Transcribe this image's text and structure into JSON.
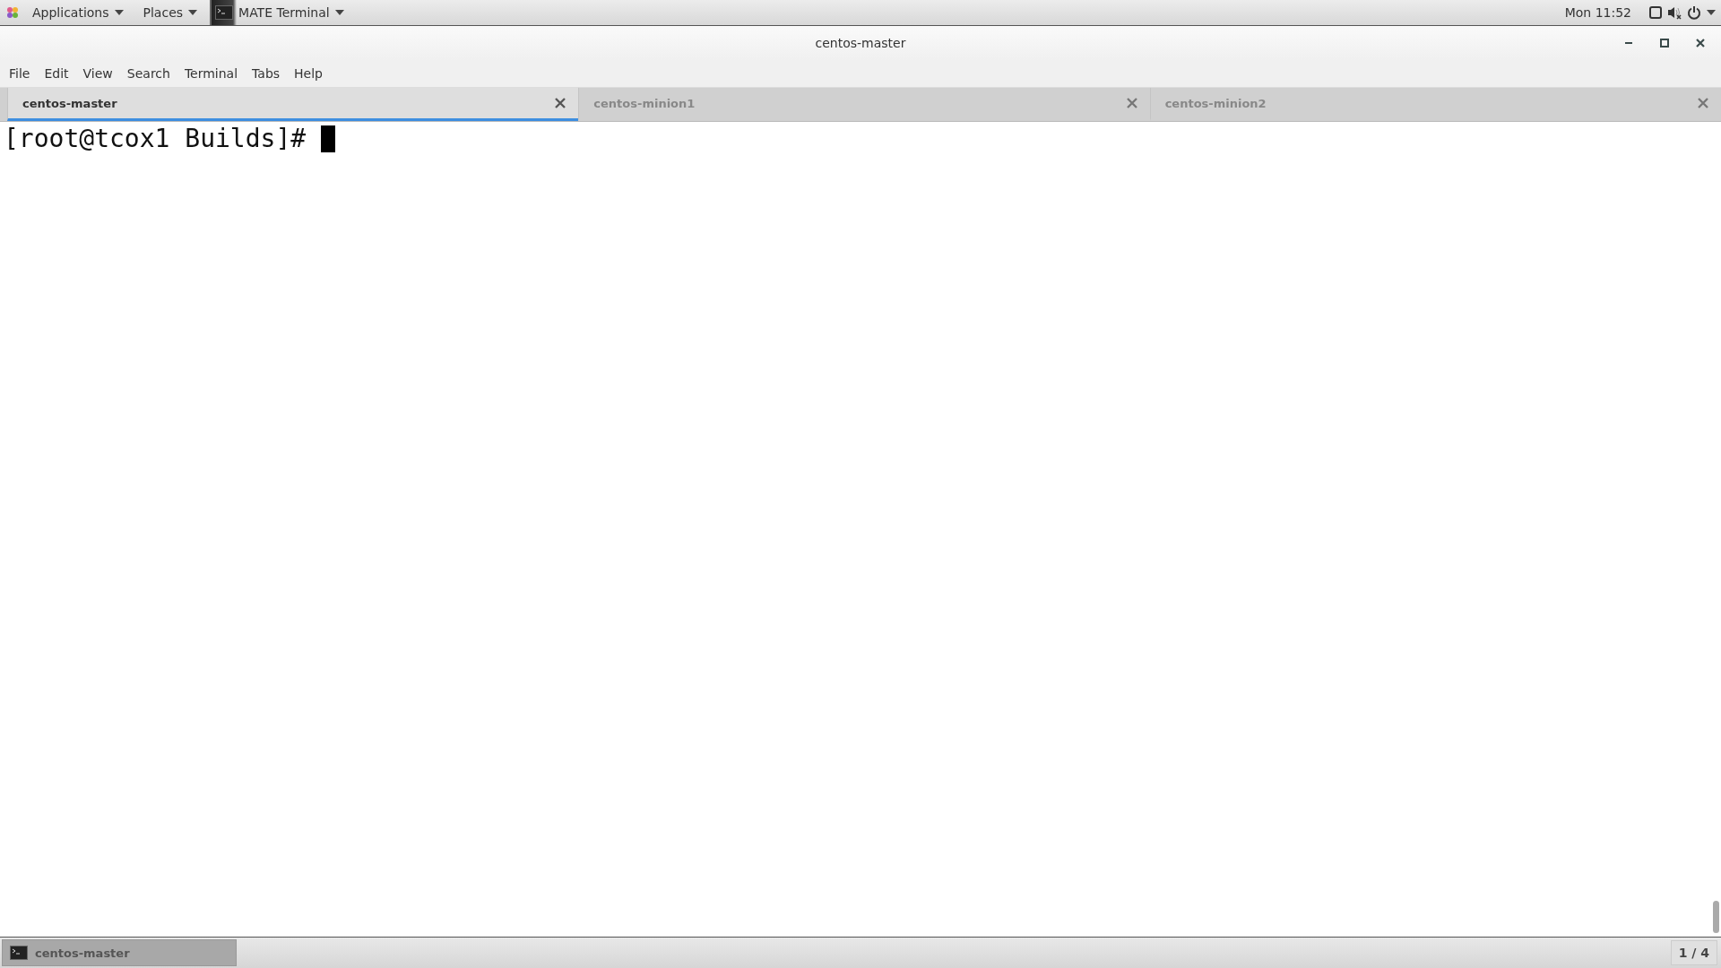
{
  "top_panel": {
    "menus": [
      {
        "label": "Applications"
      },
      {
        "label": "Places"
      }
    ],
    "task": {
      "label": "MATE Terminal"
    },
    "clock": "Mon 11:52"
  },
  "window": {
    "title": "centos-master"
  },
  "menu_bar": [
    "File",
    "Edit",
    "View",
    "Search",
    "Terminal",
    "Tabs",
    "Help"
  ],
  "tabs": [
    {
      "label": "centos-master",
      "selected": true
    },
    {
      "label": "centos-minion1",
      "selected": false
    },
    {
      "label": "centos-minion2",
      "selected": false
    }
  ],
  "terminal": {
    "lines": [
      "[root@tcox1 Builds]# "
    ]
  },
  "bottom_panel": {
    "tasks": [
      {
        "label": "centos-master",
        "selected": true
      }
    ],
    "workspace": "1 / 4"
  }
}
